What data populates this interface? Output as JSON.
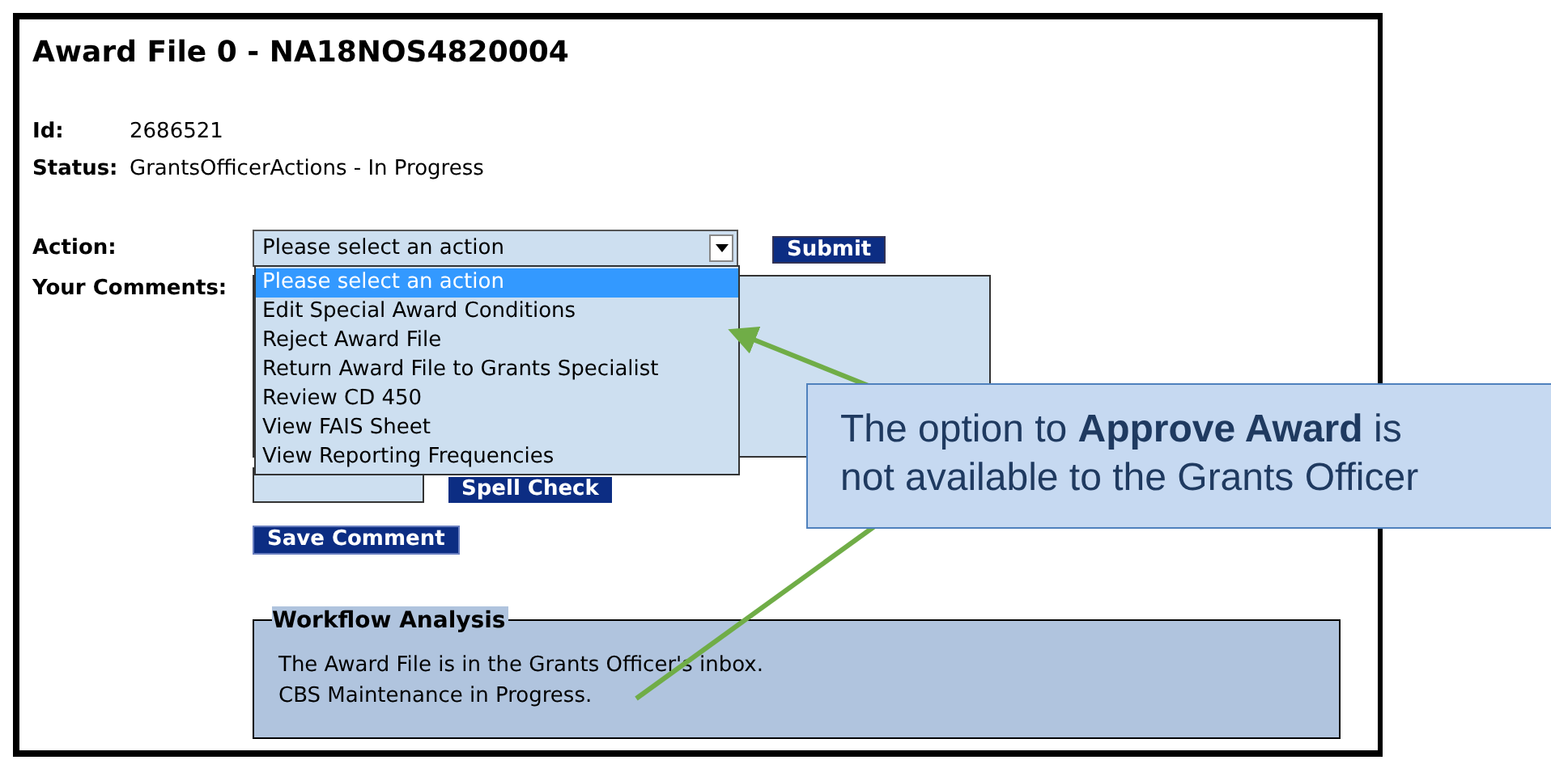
{
  "page": {
    "title": "Award File 0 - NA18NOS4820004",
    "fields": [
      {
        "label": "Id:",
        "value": "2686521"
      },
      {
        "label": "Status:",
        "value": "GrantsOfficerActions - In Progress"
      }
    ],
    "action": {
      "label": "Action:",
      "value": "Please select an action",
      "expanded": true,
      "options": [
        {
          "label": "Please select an action",
          "selected": true
        },
        {
          "label": "Edit Special Award Conditions",
          "selected": false
        },
        {
          "label": "Reject Award File",
          "selected": false
        },
        {
          "label": "Return Award File to Grants Specialist",
          "selected": false
        },
        {
          "label": "Review CD 450",
          "selected": false
        },
        {
          "label": "View FAIS Sheet",
          "selected": false
        },
        {
          "label": "View Reporting Frequencies",
          "selected": false
        }
      ]
    },
    "submit_button": "Submit",
    "comments_label": "Your Comments:",
    "spell_check_button": "Spell Check",
    "save_comment_button": "Save Comment",
    "workflow": {
      "title": "Workflow Analysis",
      "lines": [
        "The Award File is in the Grants Officer's inbox.",
        "CBS Maintenance in Progress."
      ]
    }
  },
  "callout": {
    "text": "The option to **Approve Award** is not available to the Grants Officer"
  }
}
